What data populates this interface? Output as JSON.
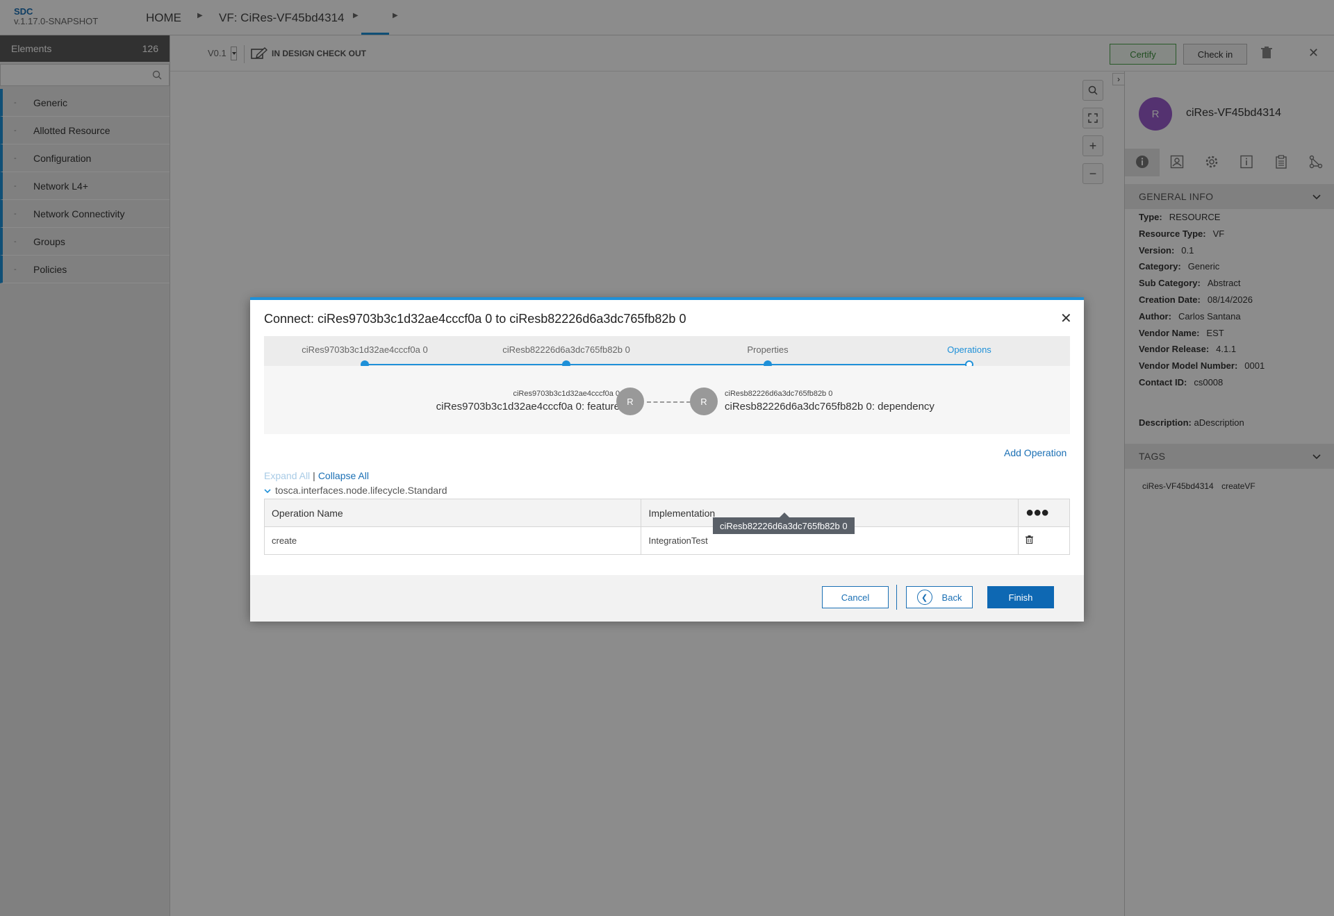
{
  "header": {
    "brand_name": "SDC",
    "brand_version": "v.1.17.0-SNAPSHOT",
    "breadcrumb_home": "HOME",
    "breadcrumb_vf": "VF: CiRes-VF45bd4314"
  },
  "sidebar": {
    "title": "Elements",
    "count": "126",
    "search_placeholder": "",
    "items": [
      {
        "label": "Generic"
      },
      {
        "label": "Allotted Resource"
      },
      {
        "label": "Configuration"
      },
      {
        "label": "Network L4+"
      },
      {
        "label": "Network Connectivity"
      },
      {
        "label": "Groups"
      },
      {
        "label": "Policies"
      }
    ]
  },
  "toolbar": {
    "version": "V0.1",
    "status": "IN DESIGN CHECK OUT",
    "certify_label": "Certify",
    "checkin_label": "Check in"
  },
  "right_panel": {
    "avatar_letter": "R",
    "component_name": "ciRes-VF45bd4314",
    "general_info_title": "GENERAL INFO",
    "info": [
      {
        "label": "Type:",
        "value": "RESOURCE"
      },
      {
        "label": "Resource Type:",
        "value": "VF"
      },
      {
        "label": "Version:",
        "value": "0.1"
      },
      {
        "label": "Category:",
        "value": "Generic"
      },
      {
        "label": "Sub Category:",
        "value": "Abstract"
      },
      {
        "label": "Creation Date:",
        "value": "08/14/2026"
      },
      {
        "label": "Author:",
        "value": "Carlos Santana"
      },
      {
        "label": "Vendor Name:",
        "value": "EST"
      },
      {
        "label": "Vendor Release:",
        "value": "4.1.1"
      },
      {
        "label": "Vendor Model Number:",
        "value": "0001"
      },
      {
        "label": "Contact ID:",
        "value": "cs0008"
      }
    ],
    "description_label": "Description:",
    "description_value": "aDescription",
    "tags_title": "TAGS",
    "tags": [
      "ciRes-VF45bd4314",
      "createVF"
    ]
  },
  "modal": {
    "title": "Connect: ciRes9703b3c1d32ae4cccf0a 0 to ciResb82226d6a3dc765fb82b 0",
    "steps": [
      {
        "label": "ciRes9703b3c1d32ae4cccf0a 0"
      },
      {
        "label": "ciResb82226d6a3dc765fb82b 0"
      },
      {
        "label": "Properties"
      },
      {
        "label": "Operations"
      }
    ],
    "source_small": "ciRes9703b3c1d32ae4cccf0a 0",
    "source_big": "ciRes9703b3c1d32ae4cccf0a 0: feature",
    "source_letter": "R",
    "target_letter": "R",
    "target_small": "ciResb82226d6a3dc765fb82b 0",
    "target_big": "ciResb82226d6a3dc765fb82b 0: dependency",
    "add_operation": "Add Operation",
    "expand_all": "Expand All",
    "separator": "|",
    "collapse_all": "Collapse All",
    "interface_name": "tosca.interfaces.node.lifecycle.Standard",
    "table": {
      "col_name": "Operation Name",
      "col_impl": "Implementation",
      "col_actions": "●●●",
      "rows": [
        {
          "name": "create",
          "implementation": "IntegrationTest"
        }
      ]
    },
    "tooltip": "ciResb82226d6a3dc765fb82b 0",
    "cancel_label": "Cancel",
    "back_label": "Back",
    "finish_label": "Finish"
  }
}
